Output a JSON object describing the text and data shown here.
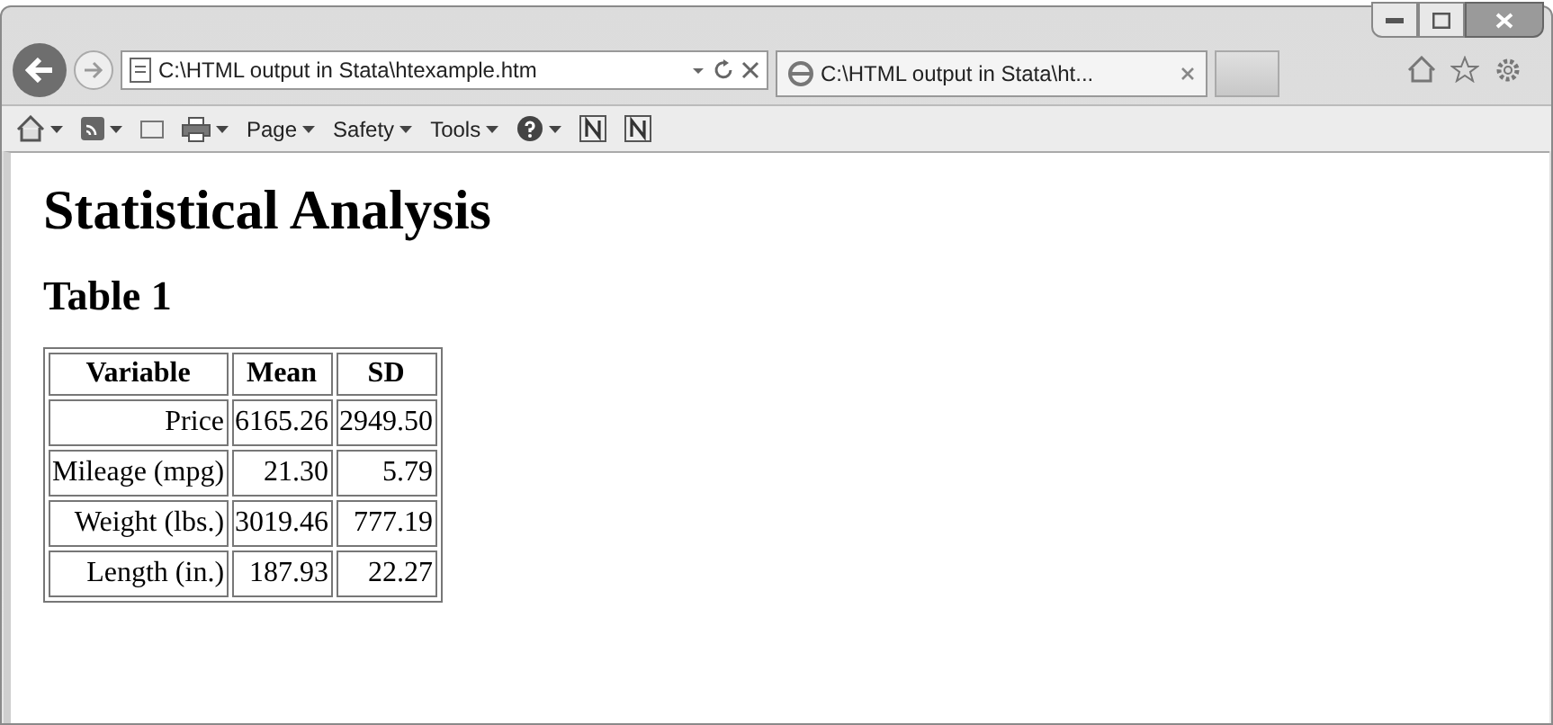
{
  "address_bar": {
    "url": "C:\\HTML output in Stata\\htexample.htm"
  },
  "tabs": [
    {
      "title": "C:\\HTML output in Stata\\ht...",
      "selected": true
    }
  ],
  "command_bar": [
    {
      "kind": "icon",
      "dropdown": true
    },
    {
      "kind": "icon",
      "dropdown": true
    },
    {
      "kind": "icon",
      "dropdown": false
    },
    {
      "kind": "icon",
      "dropdown": true
    },
    {
      "kind": "menu",
      "label": "Page"
    },
    {
      "kind": "menu",
      "label": "Safety"
    },
    {
      "kind": "menu",
      "label": "Tools"
    },
    {
      "kind": "icon",
      "dropdown": true
    },
    {
      "kind": "icon",
      "dropdown": false
    },
    {
      "kind": "icon",
      "dropdown": false
    }
  ],
  "page": {
    "heading": "Statistical Analysis",
    "subheading": "Table 1",
    "table": {
      "columns": [
        "Variable",
        "Mean",
        "SD"
      ],
      "rows": [
        [
          "Price",
          "6165.26",
          "2949.50"
        ],
        [
          "Mileage (mpg)",
          "21.30",
          "5.79"
        ],
        [
          "Weight (lbs.)",
          "3019.46",
          "777.19"
        ],
        [
          "Length (in.)",
          "187.93",
          "22.27"
        ]
      ]
    }
  }
}
